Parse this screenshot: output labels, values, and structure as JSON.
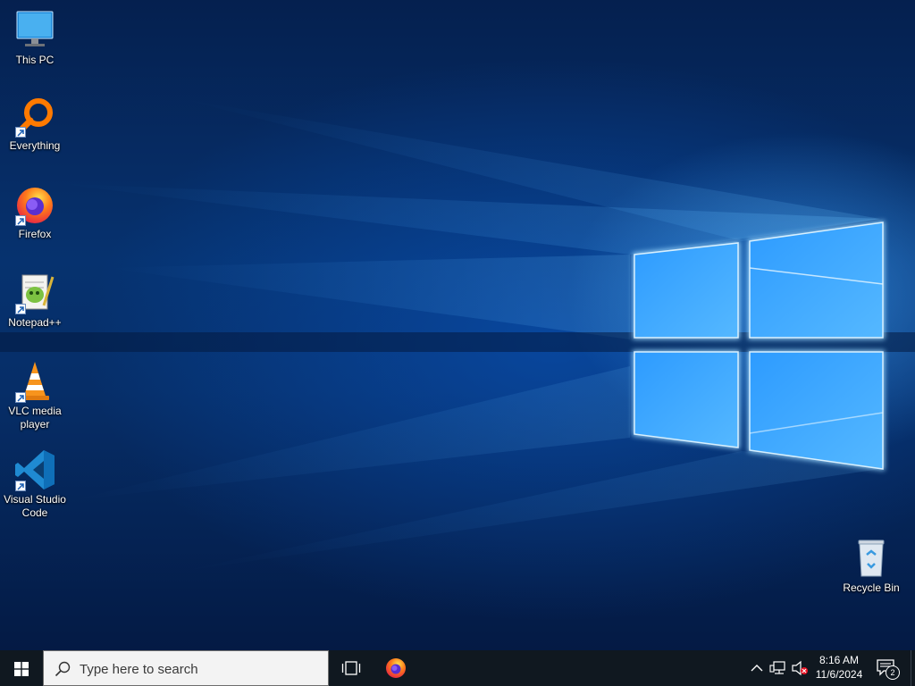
{
  "desktop": {
    "icons": [
      {
        "label": "This PC",
        "icon": "monitor-icon",
        "shortcut": false
      },
      {
        "label": "Everything",
        "icon": "everything-icon",
        "shortcut": true
      },
      {
        "label": "Firefox",
        "icon": "firefox-icon",
        "shortcut": true
      },
      {
        "label": "Notepad++",
        "icon": "notepad-plus-plus-icon",
        "shortcut": true
      },
      {
        "label": "VLC media player",
        "icon": "vlc-icon",
        "shortcut": true
      },
      {
        "label": "Visual Studio Code",
        "icon": "vscode-icon",
        "shortcut": true
      },
      {
        "label": "Recycle Bin",
        "icon": "recycle-bin-icon",
        "shortcut": false
      }
    ]
  },
  "taskbar": {
    "search_placeholder": "Type here to search",
    "pinned": [
      {
        "name": "Firefox",
        "icon": "firefox-icon"
      }
    ],
    "tray": {
      "time": "8:16 AM",
      "date": "11/6/2024",
      "notification_count": "2"
    }
  },
  "colors": {
    "taskbar": "#101820",
    "search_bg": "#f3f3f3",
    "wallpaper_accent": "#3aa0ff"
  }
}
